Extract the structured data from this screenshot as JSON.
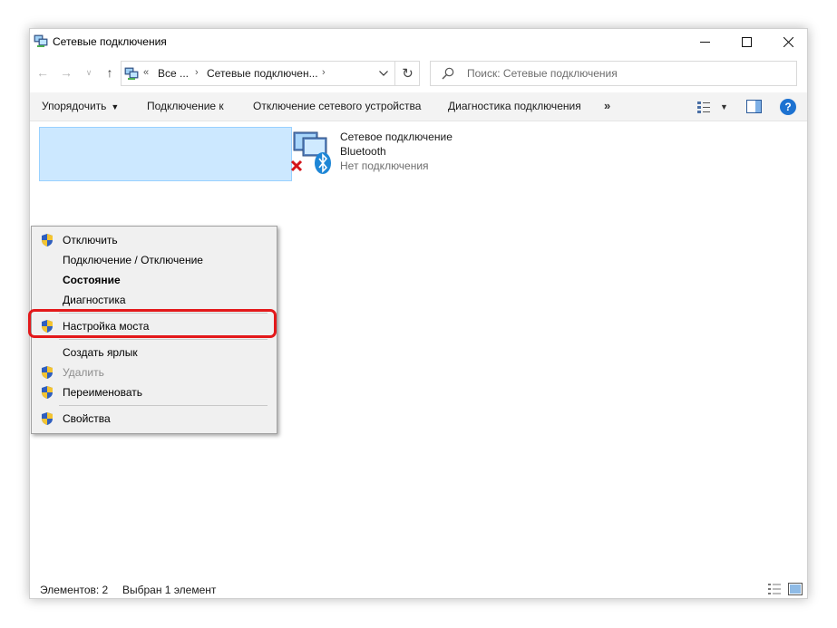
{
  "window": {
    "title": "Сетевые подключения"
  },
  "navigation": {
    "address_segments": [
      "Все ...",
      "Сетевые подключен..."
    ],
    "search_placeholder": "Поиск: Сетевые подключения"
  },
  "commandbar": {
    "organize_label": "Упорядочить",
    "connect_label": "Подключение к",
    "disable_label": "Отключение сетевого устройства",
    "diagnose_label": "Диагностика подключения",
    "more_label": "»"
  },
  "connections": [
    {
      "name": "Сетевое подключение",
      "type": "Bluetooth",
      "status": "Нет подключения"
    }
  ],
  "context_menu": {
    "items": [
      {
        "label": "Отключить",
        "shield": true
      },
      {
        "label": "Подключение / Отключение",
        "shield": false
      },
      {
        "label": "Состояние",
        "shield": false,
        "bold": true
      },
      {
        "label": "Диагностика",
        "shield": false
      },
      {
        "label": "Настройка моста",
        "shield": true
      },
      {
        "label": "Создать ярлык",
        "shield": false
      },
      {
        "label": "Удалить",
        "shield": true,
        "disabled": true
      },
      {
        "label": "Переименовать",
        "shield": true
      },
      {
        "label": "Свойства",
        "shield": true,
        "highlighted": true
      }
    ],
    "highlight_color": "#e3191b"
  },
  "statusbar": {
    "items_count": "Элементов: 2",
    "selected": "Выбран 1 элемент"
  },
  "colors": {
    "selection_bg": "#cce8ff",
    "accent": "#1d72d1"
  }
}
